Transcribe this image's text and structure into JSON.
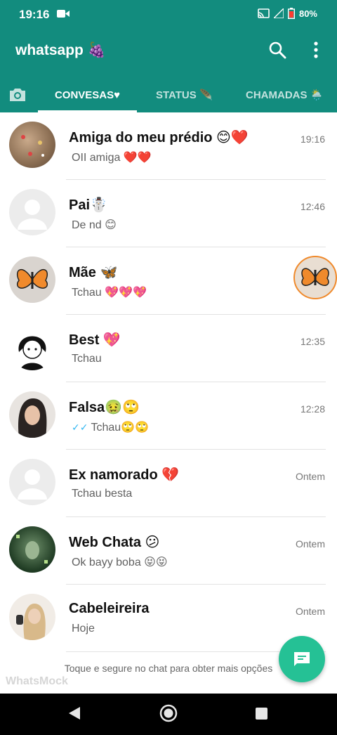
{
  "status_bar": {
    "time": "19:16",
    "battery": "80%",
    "icons": [
      "video-record-icon",
      "cast-icon",
      "signal-icon",
      "battery-icon"
    ]
  },
  "app_bar": {
    "title": "whatsapp 🍇",
    "icons": [
      "search-icon",
      "more-vert-icon"
    ],
    "color": "#128c7e"
  },
  "tabs": [
    {
      "label": "CONVESAS♥",
      "active": true
    },
    {
      "label": "STATUS 🪶",
      "active": false
    },
    {
      "label": "CHAMADAS 🌦️",
      "active": false
    }
  ],
  "chats": [
    {
      "name": "Amiga do meu prédio 😊❤️",
      "message": "OII amiga ❤️❤️",
      "time": "19:16",
      "ticks": false
    },
    {
      "name": "Pai☃️",
      "message": "De nd 😊",
      "time": "12:46",
      "ticks": false
    },
    {
      "name": "Mãe 🦋",
      "message": "Tchau 💖💖💖",
      "time": "",
      "ticks": false
    },
    {
      "name": "Best 💖",
      "message": "Tchau",
      "time": "12:35",
      "ticks": false
    },
    {
      "name": "Falsa🤢🙄",
      "message": "Tchau🙄🙄",
      "time": "12:28",
      "ticks": true
    },
    {
      "name": "Ex namorado 💔",
      "message": "Tchau besta",
      "time": "Ontem",
      "ticks": false
    },
    {
      "name": "Web Chata 😕",
      "message": "Ok bayy boba 😝😝",
      "time": "Ontem",
      "ticks": false
    },
    {
      "name": "Cabeleireira",
      "message": "Hoje",
      "time": "Ontem",
      "ticks": false
    }
  ],
  "hint": "Toque e segure no chat para obter mais opções",
  "watermark": "WhatsMock",
  "fab_icon": "new-chat-icon",
  "accent": "#25c195"
}
